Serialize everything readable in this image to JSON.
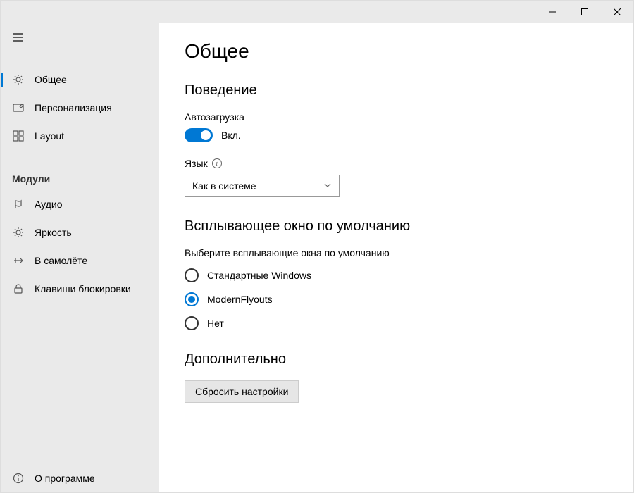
{
  "window": {
    "minimize": "—",
    "maximize": "☐",
    "close": "✕"
  },
  "sidebar": {
    "items": [
      {
        "label": "Общее",
        "icon": "gear"
      },
      {
        "label": "Персонализация",
        "icon": "pencil"
      },
      {
        "label": "Layout",
        "icon": "grid"
      }
    ],
    "section_label": "Модули",
    "modules": [
      {
        "label": "Аудио",
        "icon": "audio"
      },
      {
        "label": "Яркость",
        "icon": "brightness"
      },
      {
        "label": "В самолёте",
        "icon": "airplane"
      },
      {
        "label": "Клавиши блокировки",
        "icon": "lock"
      }
    ],
    "footer": {
      "label": "О программе",
      "icon": "info"
    }
  },
  "page": {
    "title": "Общее",
    "behavior": {
      "title": "Поведение",
      "autostart_label": "Автозагрузка",
      "autostart_state": "Вкл.",
      "language_label": "Язык",
      "language_value": "Как в системе"
    },
    "default_flyout": {
      "title": "Всплывающее окно по умолчанию",
      "help": "Выберите всплывающие окна по умолчанию",
      "options": [
        {
          "label": "Стандартные Windows",
          "checked": false
        },
        {
          "label": "ModernFlyouts",
          "checked": true
        },
        {
          "label": "Нет",
          "checked": false
        }
      ]
    },
    "advanced": {
      "title": "Дополнительно",
      "reset_label": "Сбросить настройки"
    }
  }
}
